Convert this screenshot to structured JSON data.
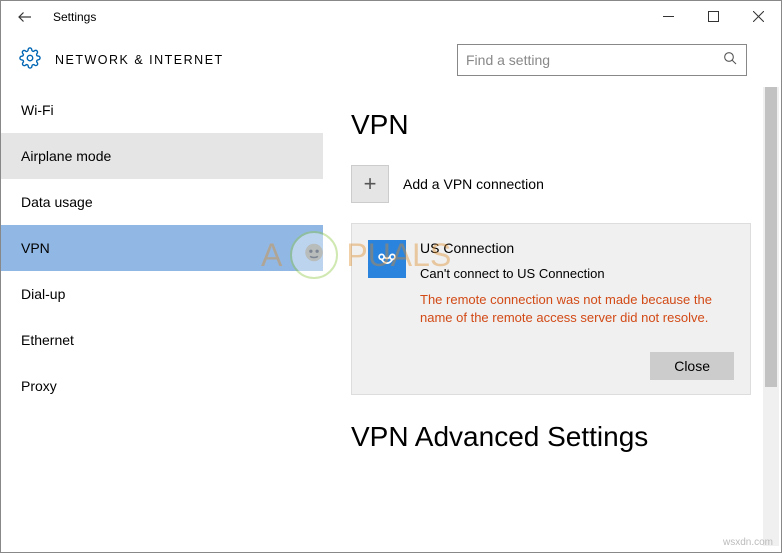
{
  "titlebar": {
    "title": "Settings"
  },
  "header": {
    "title": "NETWORK & INTERNET",
    "search_placeholder": "Find a setting"
  },
  "sidebar": {
    "items": [
      {
        "label": "Wi-Fi",
        "state": "normal"
      },
      {
        "label": "Airplane mode",
        "state": "hover"
      },
      {
        "label": "Data usage",
        "state": "normal"
      },
      {
        "label": "VPN",
        "state": "selected"
      },
      {
        "label": "Dial-up",
        "state": "normal"
      },
      {
        "label": "Ethernet",
        "state": "normal"
      },
      {
        "label": "Proxy",
        "state": "normal"
      }
    ]
  },
  "main": {
    "heading": "VPN",
    "add_label": "Add a VPN connection",
    "connection": {
      "name": "US Connection",
      "status": "Can't connect to US Connection",
      "error": "The remote connection was not made because the name of the remote access server did not resolve.",
      "close_label": "Close"
    },
    "advanced_heading": "VPN Advanced Settings"
  },
  "watermark": {
    "brand_left": "A",
    "brand_right": "PUALS"
  },
  "source_mark": "wsxdn.com"
}
